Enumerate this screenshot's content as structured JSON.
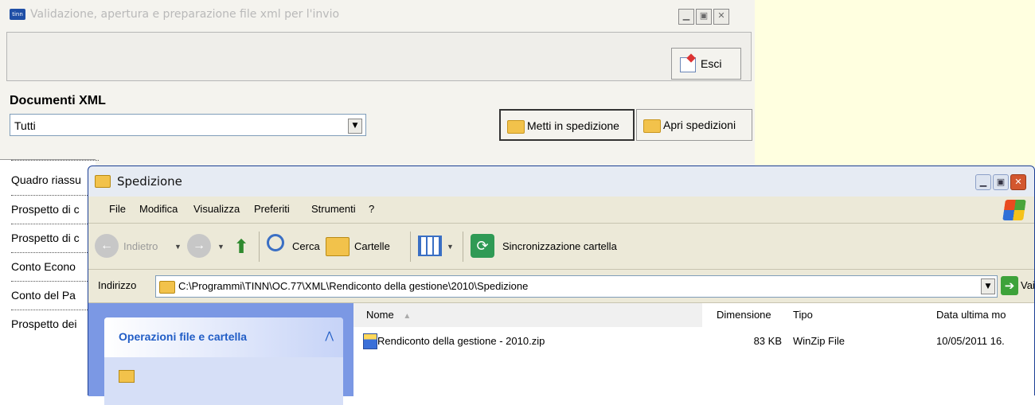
{
  "bg_window": {
    "app_icon_text": "tinn",
    "title": "Validazione, apertura e preparazione file xml per l'invio",
    "esci_label": "Esci",
    "documents_label": "Documenti XML",
    "documents_select_value": "Tutti",
    "metti_label": "Metti in spedizione",
    "apri_label": "Apri spedizioni",
    "list_items": [
      "Quadro riassu",
      "Prospetto di c",
      "Prospetto di c",
      "Conto Econo",
      "Conto del Pa",
      "Prospetto dei"
    ]
  },
  "explorer": {
    "title": "Spedizione",
    "menu": [
      "File",
      "Modifica",
      "Visualizza",
      "Preferiti",
      "Strumenti",
      "?"
    ],
    "toolbar": {
      "back": "Indietro",
      "search": "Cerca",
      "folders": "Cartelle",
      "sync": "Sincronizzazione cartella"
    },
    "address_label": "Indirizzo",
    "address_path": "C:\\Programmi\\TINN\\OC.77\\XML\\Rendiconto della gestione\\2010\\Spedizione",
    "go_label": "Vai",
    "taskpane_title": "Operazioni file e cartella",
    "columns": [
      "Nome",
      "Dimensione",
      "Tipo",
      "Data ultima mo"
    ],
    "files": [
      {
        "name": "Rendiconto della gestione - 2010.zip",
        "size": "83 KB",
        "type": "WinZip File",
        "date": "10/05/2011 16."
      }
    ]
  }
}
